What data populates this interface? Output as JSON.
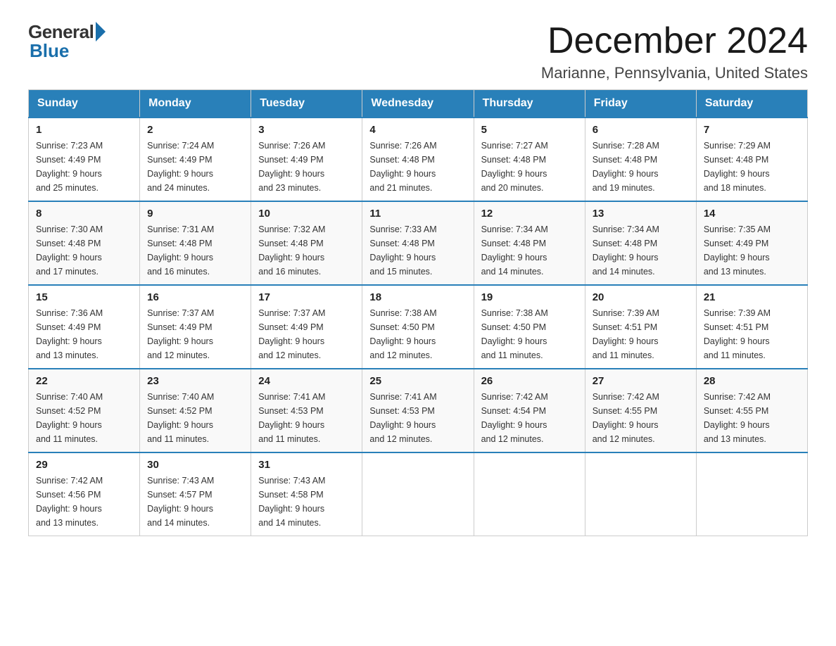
{
  "header": {
    "logo_general": "General",
    "logo_blue": "Blue",
    "month_title": "December 2024",
    "location": "Marianne, Pennsylvania, United States"
  },
  "weekdays": [
    "Sunday",
    "Monday",
    "Tuesday",
    "Wednesday",
    "Thursday",
    "Friday",
    "Saturday"
  ],
  "weeks": [
    [
      {
        "day": "1",
        "sunrise": "7:23 AM",
        "sunset": "4:49 PM",
        "daylight": "9 hours and 25 minutes."
      },
      {
        "day": "2",
        "sunrise": "7:24 AM",
        "sunset": "4:49 PM",
        "daylight": "9 hours and 24 minutes."
      },
      {
        "day": "3",
        "sunrise": "7:26 AM",
        "sunset": "4:49 PM",
        "daylight": "9 hours and 23 minutes."
      },
      {
        "day": "4",
        "sunrise": "7:26 AM",
        "sunset": "4:48 PM",
        "daylight": "9 hours and 21 minutes."
      },
      {
        "day": "5",
        "sunrise": "7:27 AM",
        "sunset": "4:48 PM",
        "daylight": "9 hours and 20 minutes."
      },
      {
        "day": "6",
        "sunrise": "7:28 AM",
        "sunset": "4:48 PM",
        "daylight": "9 hours and 19 minutes."
      },
      {
        "day": "7",
        "sunrise": "7:29 AM",
        "sunset": "4:48 PM",
        "daylight": "9 hours and 18 minutes."
      }
    ],
    [
      {
        "day": "8",
        "sunrise": "7:30 AM",
        "sunset": "4:48 PM",
        "daylight": "9 hours and 17 minutes."
      },
      {
        "day": "9",
        "sunrise": "7:31 AM",
        "sunset": "4:48 PM",
        "daylight": "9 hours and 16 minutes."
      },
      {
        "day": "10",
        "sunrise": "7:32 AM",
        "sunset": "4:48 PM",
        "daylight": "9 hours and 16 minutes."
      },
      {
        "day": "11",
        "sunrise": "7:33 AM",
        "sunset": "4:48 PM",
        "daylight": "9 hours and 15 minutes."
      },
      {
        "day": "12",
        "sunrise": "7:34 AM",
        "sunset": "4:48 PM",
        "daylight": "9 hours and 14 minutes."
      },
      {
        "day": "13",
        "sunrise": "7:34 AM",
        "sunset": "4:48 PM",
        "daylight": "9 hours and 14 minutes."
      },
      {
        "day": "14",
        "sunrise": "7:35 AM",
        "sunset": "4:49 PM",
        "daylight": "9 hours and 13 minutes."
      }
    ],
    [
      {
        "day": "15",
        "sunrise": "7:36 AM",
        "sunset": "4:49 PM",
        "daylight": "9 hours and 13 minutes."
      },
      {
        "day": "16",
        "sunrise": "7:37 AM",
        "sunset": "4:49 PM",
        "daylight": "9 hours and 12 minutes."
      },
      {
        "day": "17",
        "sunrise": "7:37 AM",
        "sunset": "4:49 PM",
        "daylight": "9 hours and 12 minutes."
      },
      {
        "day": "18",
        "sunrise": "7:38 AM",
        "sunset": "4:50 PM",
        "daylight": "9 hours and 12 minutes."
      },
      {
        "day": "19",
        "sunrise": "7:38 AM",
        "sunset": "4:50 PM",
        "daylight": "9 hours and 11 minutes."
      },
      {
        "day": "20",
        "sunrise": "7:39 AM",
        "sunset": "4:51 PM",
        "daylight": "9 hours and 11 minutes."
      },
      {
        "day": "21",
        "sunrise": "7:39 AM",
        "sunset": "4:51 PM",
        "daylight": "9 hours and 11 minutes."
      }
    ],
    [
      {
        "day": "22",
        "sunrise": "7:40 AM",
        "sunset": "4:52 PM",
        "daylight": "9 hours and 11 minutes."
      },
      {
        "day": "23",
        "sunrise": "7:40 AM",
        "sunset": "4:52 PM",
        "daylight": "9 hours and 11 minutes."
      },
      {
        "day": "24",
        "sunrise": "7:41 AM",
        "sunset": "4:53 PM",
        "daylight": "9 hours and 11 minutes."
      },
      {
        "day": "25",
        "sunrise": "7:41 AM",
        "sunset": "4:53 PM",
        "daylight": "9 hours and 12 minutes."
      },
      {
        "day": "26",
        "sunrise": "7:42 AM",
        "sunset": "4:54 PM",
        "daylight": "9 hours and 12 minutes."
      },
      {
        "day": "27",
        "sunrise": "7:42 AM",
        "sunset": "4:55 PM",
        "daylight": "9 hours and 12 minutes."
      },
      {
        "day": "28",
        "sunrise": "7:42 AM",
        "sunset": "4:55 PM",
        "daylight": "9 hours and 13 minutes."
      }
    ],
    [
      {
        "day": "29",
        "sunrise": "7:42 AM",
        "sunset": "4:56 PM",
        "daylight": "9 hours and 13 minutes."
      },
      {
        "day": "30",
        "sunrise": "7:43 AM",
        "sunset": "4:57 PM",
        "daylight": "9 hours and 14 minutes."
      },
      {
        "day": "31",
        "sunrise": "7:43 AM",
        "sunset": "4:58 PM",
        "daylight": "9 hours and 14 minutes."
      },
      null,
      null,
      null,
      null
    ]
  ],
  "labels": {
    "sunrise": "Sunrise:",
    "sunset": "Sunset:",
    "daylight": "Daylight:"
  }
}
